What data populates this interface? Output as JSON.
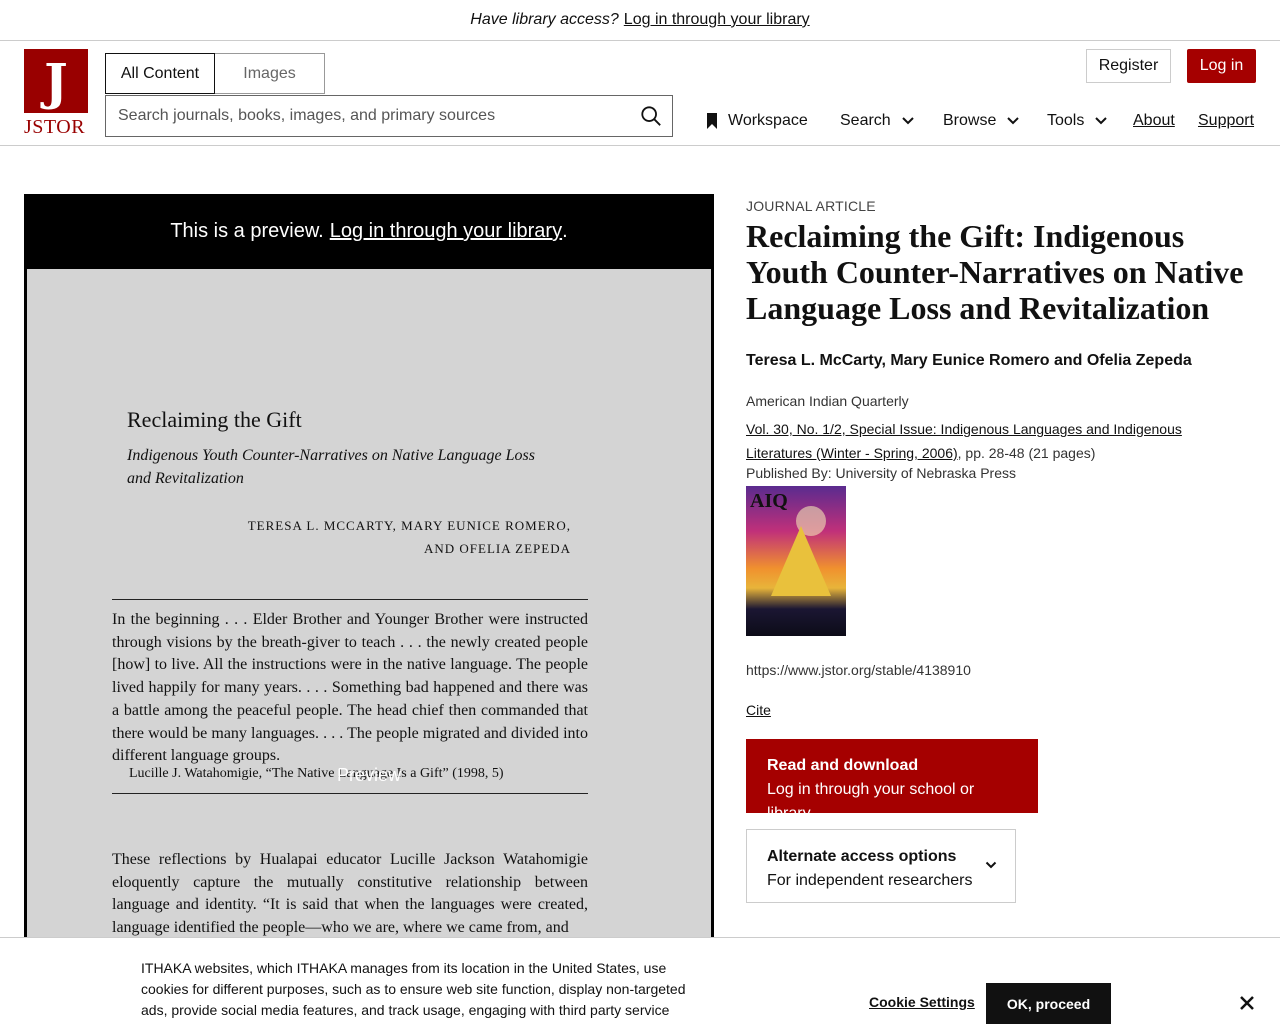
{
  "banner": {
    "question": "Have library access?",
    "link": "Log in through your library"
  },
  "header": {
    "logo_text": "JSTOR",
    "logo_glyph": "J",
    "tabs": [
      {
        "label": "All Content"
      },
      {
        "label": "Images"
      }
    ],
    "search_placeholder": "Search journals, books, images, and primary sources",
    "register_label": "Register",
    "login_label": "Log in",
    "nav": {
      "workspace": "Workspace",
      "search": "Search",
      "browse": "Browse",
      "tools": "Tools",
      "about": "About",
      "support": "Support"
    }
  },
  "preview": {
    "notice": "This is a preview.",
    "notice_link": "Log in through your library",
    "notice_end": ".",
    "watermark": "Preview",
    "page": {
      "title": "Reclaiming the Gift",
      "subtitle": "Indigenous Youth Counter-Narratives on Native Language Loss and Revitalization",
      "authors_line1": "TERESA L. MCCARTY, MARY EUNICE ROMERO,",
      "authors_line2": "AND OFELIA ZEPEDA",
      "quote": "In the beginning . . . Elder Brother and Younger Brother were instructed through visions by the breath-giver to teach . . . the newly created people [how] to live. All the instructions were in the native language. The people lived happily for many years. . . . Something bad happened and there was a battle among the peaceful people. The head chief then commanded that there would be many languages. . . . The people migrated and divided into different language groups.",
      "attribution": "Lucille J. Watahomigie, “The Native Language Is a Gift” (1998, 5)",
      "body": "These reflections by Hualapai educator Lucille Jackson Watahomigie eloquently capture the mutually constitutive relationship between language and identity. “It is said that when the languages were created, language identified the people—who we are, where we came from, and"
    }
  },
  "article": {
    "type": "JOURNAL ARTICLE",
    "title": "Reclaiming the Gift: Indigenous Youth Counter-Narratives on Native Language Loss and Revitalization",
    "authors": "Teresa L. McCarty, Mary Eunice Romero and Ofelia Zepeda",
    "journal": "American Indian Quarterly",
    "issue_link": "Vol. 30, No. 1/2, Special Issue: Indigenous Languages and Indigenous Literatures (Winter - Spring, 2006)",
    "pages": ", pp. 28-48 (21 pages)",
    "publisher": "Published By: University of Nebraska Press",
    "cover_text": "AIQ",
    "url": "https://www.jstor.org/stable/4138910",
    "cite": "Cite",
    "read_title": "Read and download",
    "read_sub": "Log in through your school or library",
    "alt_title": "Alternate access options",
    "alt_sub": "For independent researchers"
  },
  "cookie": {
    "text": "ITHAKA websites, which ITHAKA manages from its location in the United States, use cookies for different purposes, such as to ensure web site function, display non-targeted ads, provide social media features, and track usage, engaging with third party service",
    "settings": "Cookie Settings",
    "ok": "OK, proceed"
  },
  "colors": {
    "brand": "#990000",
    "button_red": "#a50000"
  },
  "icons": [
    "search-icon",
    "bookmark-icon",
    "chevron-down-icon",
    "close-icon"
  ]
}
